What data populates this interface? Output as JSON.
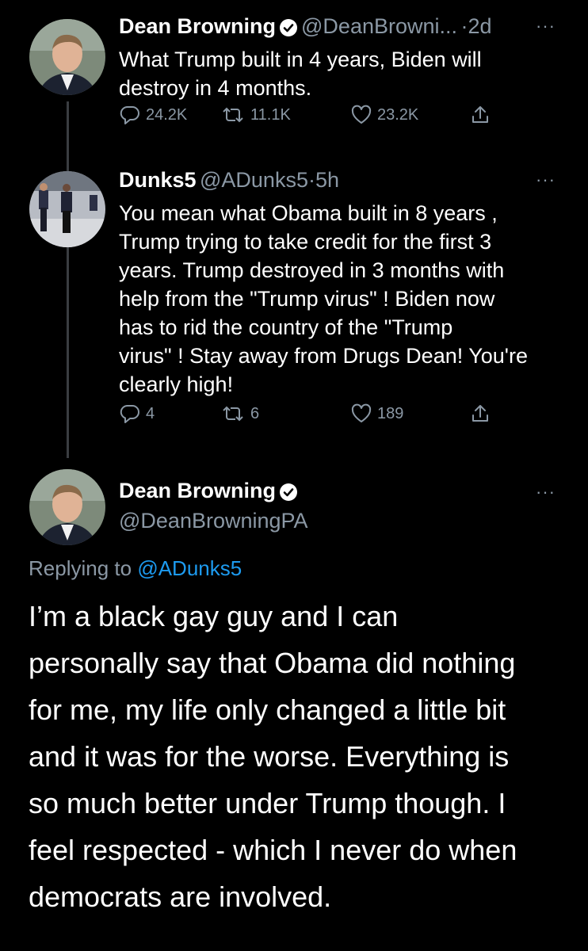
{
  "tweet1": {
    "name": "Dean Browning",
    "handle": "@DeanBrowni...",
    "time": "2d",
    "text_lines": [
      "What Trump built in 4 years, Biden will",
      "destroy in 4 months."
    ],
    "replies": "24.2K",
    "retweets": "11.1K",
    "likes": "23.2K"
  },
  "tweet2": {
    "name": "Dunks5",
    "handle": "@ADunks5",
    "time": "5h",
    "text_lines": [
      "You mean what Obama built in 8 years ,",
      "Trump trying to take credit for the first 3",
      "years. Trump destroyed in 3 months with",
      "help from the \"Trump virus\" ! Biden now",
      "has to rid the country of the \"Trump",
      "virus\" ! Stay away from Drugs Dean! You're",
      "clearly high!"
    ],
    "replies": "4",
    "retweets": "6",
    "likes": "189"
  },
  "tweet3": {
    "name": "Dean Browning",
    "handle": "@DeanBrowningPA",
    "replying_prefix": "Replying to",
    "replying_to": "@ADunks5",
    "text_lines": [
      "I’m a black gay guy and I can",
      "personally say that Obama did nothing",
      "for me, my life only changed a little bit",
      "and it was for the worse. Everything is",
      "so much better under Trump though. I",
      "feel respected - which I never do when",
      "democrats are involved."
    ]
  },
  "separator": "·",
  "more_label": "···",
  "colors": {
    "background": "#000000",
    "secondary": "#8b98a5",
    "link": "#1d9bf0",
    "thread_line": "#3a3d41"
  },
  "icons": [
    "verified-badge-icon",
    "reply-icon",
    "retweet-icon",
    "like-icon",
    "share-icon",
    "more-icon"
  ]
}
